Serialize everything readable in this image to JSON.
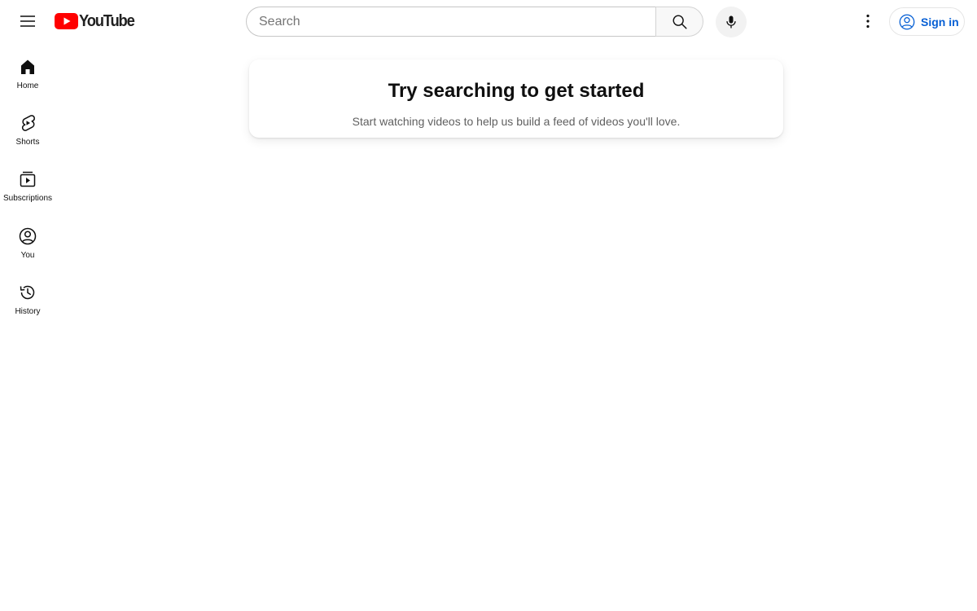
{
  "header": {
    "logo_text": "YouTube",
    "search": {
      "placeholder": "Search",
      "value": ""
    },
    "signin_label": "Sign in"
  },
  "sidebar": {
    "items": [
      {
        "label": "Home",
        "icon": "home-icon"
      },
      {
        "label": "Shorts",
        "icon": "shorts-icon"
      },
      {
        "label": "Subscriptions",
        "icon": "subscriptions-icon"
      },
      {
        "label": "You",
        "icon": "you-icon"
      },
      {
        "label": "History",
        "icon": "history-icon"
      }
    ]
  },
  "main": {
    "title": "Try searching to get started",
    "subtitle": "Start watching videos to help us build a feed of videos you'll love."
  },
  "colors": {
    "brand_red": "#ff0000",
    "link_blue": "#065fd4",
    "text_primary": "#0f0f0f",
    "text_secondary": "#606060"
  }
}
